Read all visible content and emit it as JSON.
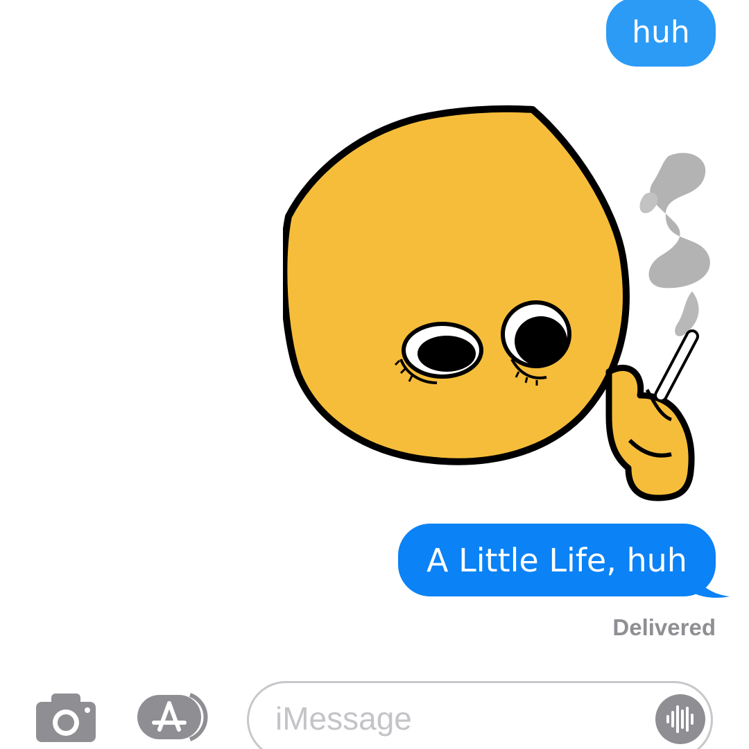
{
  "conversation": {
    "messages": [
      {
        "direction": "outgoing",
        "type": "text",
        "text": "huh",
        "color": "#2c9bf6"
      },
      {
        "direction": "outgoing",
        "type": "sticker",
        "sticker_icon": "cursed-emoji-smoking-sticker"
      },
      {
        "direction": "outgoing",
        "type": "text",
        "text": "A Little Life, huh",
        "color": "#0b82f5"
      }
    ],
    "status": "Delivered"
  },
  "composer": {
    "camera_icon": "camera-icon",
    "apps_icon": "app-store-icon",
    "placeholder": "iMessage",
    "audio_icon": "audio-waveform-icon"
  },
  "colors": {
    "bubble_blue": "#0b82f5",
    "bubble_blue_light": "#2c9bf6",
    "icon_gray": "#8e8e93",
    "status_gray": "#8e8e93"
  }
}
